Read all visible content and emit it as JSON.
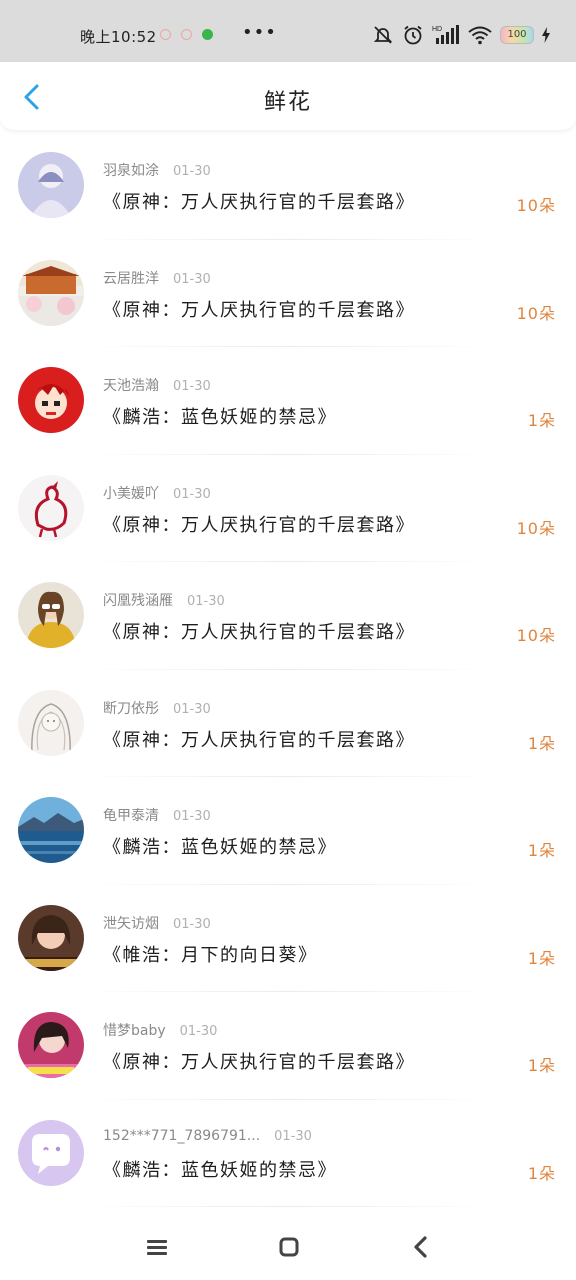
{
  "status_bar": {
    "time": "晚上10:52",
    "more": "•••",
    "battery": "100",
    "icons": [
      "mute-bell-icon",
      "alarm-icon",
      "hd-signal-icon",
      "wifi-icon",
      "battery-icon",
      "charging-icon"
    ]
  },
  "header": {
    "title": "鲜花",
    "back_icon": "chevron-left-icon"
  },
  "colors": {
    "accent_back": "#2aa3e8",
    "flower_count": "#e0853e",
    "username": "#8a8a8a",
    "date": "#b0b0b0"
  },
  "list": [
    {
      "username": "羽泉如涂",
      "date": "01-30",
      "title": "《原神：万人厌执行官的千层套路》",
      "count": "10朵"
    },
    {
      "username": "云居胜洋",
      "date": "01-30",
      "title": "《原神：万人厌执行官的千层套路》",
      "count": "10朵"
    },
    {
      "username": "天池浩瀚",
      "date": "01-30",
      "title": "《麟浩：蓝色妖姬的禁忌》",
      "count": "1朵"
    },
    {
      "username": "小美媛吖",
      "date": "01-30",
      "title": "《原神：万人厌执行官的千层套路》",
      "count": "10朵"
    },
    {
      "username": "闪凰残涵雁",
      "date": "01-30",
      "title": "《原神：万人厌执行官的千层套路》",
      "count": "10朵"
    },
    {
      "username": "断刀依彤",
      "date": "01-30",
      "title": "《原神：万人厌执行官的千层套路》",
      "count": "1朵"
    },
    {
      "username": "龟甲泰清",
      "date": "01-30",
      "title": "《麟浩：蓝色妖姬的禁忌》",
      "count": "1朵"
    },
    {
      "username": "泄矢访烟",
      "date": "01-30",
      "title": "《帷浩：月下的向日葵》",
      "count": "1朵"
    },
    {
      "username": "惜梦baby",
      "date": "01-30",
      "title": "《原神：万人厌执行官的千层套路》",
      "count": "1朵"
    },
    {
      "username": "152***771_7896791...",
      "date": "01-30",
      "title": "《麟浩：蓝色妖姬的禁忌》",
      "count": "1朵"
    }
  ],
  "nav_bar": {
    "icons": [
      "menu-icon",
      "home-square-icon",
      "back-chevron-icon"
    ]
  }
}
